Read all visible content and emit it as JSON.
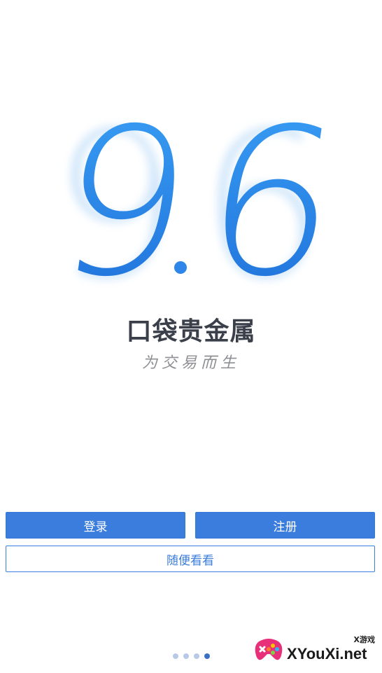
{
  "hero": {
    "version_major": "9",
    "version_minor": "6",
    "accent_color": "#2e86e8"
  },
  "app": {
    "name": "口袋贵金属",
    "slogan": "为交易而生"
  },
  "actions": {
    "login_label": "登录",
    "register_label": "注册",
    "guest_label": "随便看看"
  },
  "pager": {
    "count": 4,
    "active_index": 3
  },
  "watermark": {
    "logo_icon": "gamepad-icon",
    "sub_label": "X游戏",
    "main_label": "XYouXi.net"
  }
}
